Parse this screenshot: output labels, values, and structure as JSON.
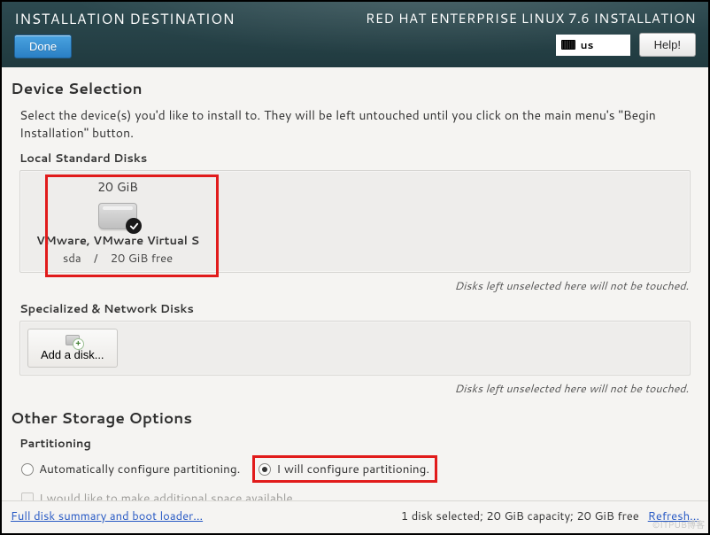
{
  "header": {
    "title_left": "INSTALLATION DESTINATION",
    "title_right": "RED HAT ENTERPRISE LINUX 7.6 INSTALLATION",
    "done_label": "Done",
    "help_label": "Help!",
    "keyboard_layout": "us"
  },
  "device_selection": {
    "heading": "Device Selection",
    "intro": "Select the device(s) you'd like to install to.  They will be left untouched until you click on the main menu's \"Begin Installation\" button.",
    "local_label": "Local Standard Disks",
    "local_hint": "Disks left unselected here will not be touched.",
    "disks": [
      {
        "size": "20 GiB",
        "name": "VMware, VMware Virtual S",
        "device": "sda",
        "sep": "/",
        "free": "20 GiB free",
        "selected": true
      }
    ],
    "network_label": "Specialized & Network Disks",
    "add_disk_label": "Add a disk...",
    "network_hint": "Disks left unselected here will not be touched."
  },
  "other_storage": {
    "heading": "Other Storage Options",
    "partitioning_label": "Partitioning",
    "radio_auto": "Automatically configure partitioning.",
    "radio_manual": "I will configure partitioning.",
    "selected": "manual",
    "extra_space_label": "I would like to make additional space available."
  },
  "footer": {
    "summary_link": "Full disk summary and boot loader...",
    "status": "1 disk selected; 20 GiB capacity; 20 GiB free",
    "refresh_link": "Refresh..."
  },
  "watermark": "©ITPUB博客"
}
